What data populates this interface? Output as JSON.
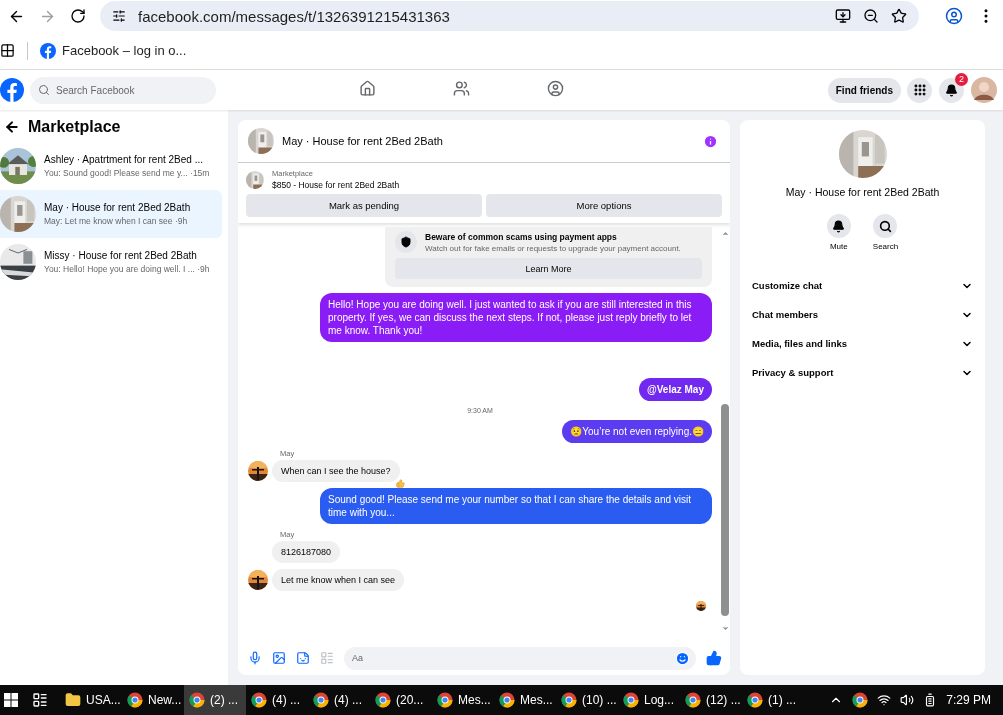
{
  "browser": {
    "url": "facebook.com/messages/t/1326391215431363",
    "bookmark": "Facebook – log in o..."
  },
  "header": {
    "search_placeholder": "Search Facebook",
    "nav": [
      {
        "kind": "home",
        "selected": false
      },
      {
        "kind": "friends",
        "selected": false
      },
      {
        "kind": "groups",
        "selected": false
      }
    ],
    "find_friends": "Find friends",
    "notification_count": "2"
  },
  "sidebar": {
    "title": "Marketplace",
    "conversations": [
      {
        "title": "Ashley · Apatrtment for rent 2Bed ...",
        "preview": "You: Sound good! Please send me y...",
        "time": "·15m",
        "selected": false
      },
      {
        "title": "May · House for rent 2Bed 2Bath",
        "preview": "May: Let me know when I can see",
        "time": "·9h",
        "selected": true
      },
      {
        "title": "Missy · House for rent 2Bed 2Bath",
        "preview": "You: Hello! Hope you are doing well. I ...",
        "time": "·9h",
        "selected": false
      }
    ]
  },
  "chat": {
    "title": "May · House for rent 2Bed 2Bath",
    "listing": {
      "label": "Marketplace",
      "item": "$850 - House for rent 2Bed 2Bath"
    },
    "actions": [
      "Mark as pending",
      "More options"
    ],
    "notice": {
      "title": "Beware of common scams using payment apps",
      "text": "Watch out for fake emails or requests to upgrade your payment account.",
      "button": "Learn More"
    },
    "messages": [
      {
        "kind": "outgoing",
        "text": "Hello! Hope you are doing well. I just wanted to ask if you are still interested in this property. If yes, we can discuss the next steps. If not, please just reply briefly to let me know. Thank you!",
        "color": "#8a1cf6",
        "bold": false
      },
      {
        "kind": "outgoing",
        "text": "@Velaz May",
        "color": "#7128ef",
        "bold": true
      },
      {
        "kind": "time",
        "text": "9:30 AM"
      },
      {
        "kind": "outgoing",
        "text": "😟You’re not even replying.😑",
        "color": "#5b3cf1",
        "bold": false
      },
      {
        "kind": "sender",
        "text": "May"
      },
      {
        "kind": "incoming",
        "text": "When can I see the house?",
        "avatar": true,
        "reacted": true
      },
      {
        "kind": "outgoing",
        "text": "Sound good! Please send me your number so that I can share the details and visit time with you...",
        "color": "#2a5cf1",
        "bold": false
      },
      {
        "kind": "sender",
        "text": "May"
      },
      {
        "kind": "incoming",
        "text": "8126187080",
        "avatar": false,
        "reacted": false
      },
      {
        "kind": "incoming",
        "text": "Let me know when I can see",
        "avatar": true,
        "reacted": false
      }
    ],
    "composer_placeholder": "Aa"
  },
  "details": {
    "name": "May · House for rent 2Bed 2Bath",
    "actions": [
      {
        "kind": "mute",
        "label": "Mute"
      },
      {
        "kind": "search",
        "label": "Search"
      }
    ],
    "sections": [
      "Customize chat",
      "Chat members",
      "Media, files and links",
      "Privacy & support"
    ]
  },
  "taskbar": {
    "items": [
      {
        "kind": "folder",
        "label": "USA...",
        "selected": false
      },
      {
        "kind": "chrome",
        "label": "New...",
        "selected": false
      },
      {
        "kind": "chrome",
        "label": "(2) ...",
        "selected": true
      },
      {
        "kind": "chrome",
        "label": "(4) ...",
        "selected": false
      },
      {
        "kind": "chrome",
        "label": "(4) ...",
        "selected": false
      },
      {
        "kind": "chrome",
        "label": "(20...",
        "selected": false
      },
      {
        "kind": "chrome",
        "label": "Mes...",
        "selected": false
      },
      {
        "kind": "chrome",
        "label": "Mes...",
        "selected": false
      },
      {
        "kind": "chrome",
        "label": "(10) ...",
        "selected": false
      },
      {
        "kind": "chrome",
        "label": "Log...",
        "selected": false
      },
      {
        "kind": "chrome",
        "label": "(12) ...",
        "selected": false
      },
      {
        "kind": "chrome",
        "label": "(1) ...",
        "selected": false
      }
    ],
    "clock": "7:29 PM"
  }
}
